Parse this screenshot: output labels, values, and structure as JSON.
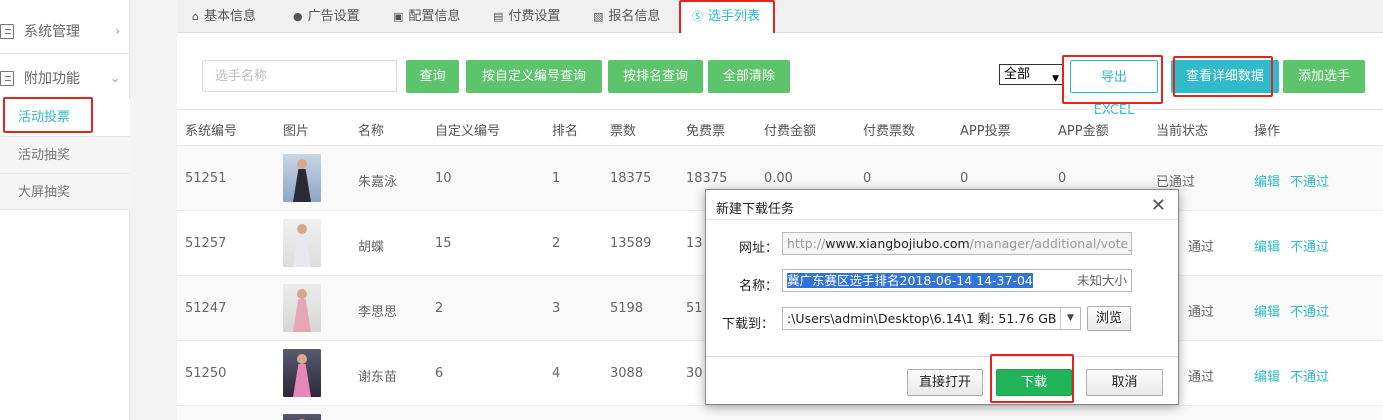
{
  "sidebar": {
    "items": [
      {
        "label": "系统管理",
        "arrow": "›"
      },
      {
        "label": "附加功能",
        "arrow": "⌄"
      }
    ],
    "sub_items": [
      {
        "label": "活动投票"
      },
      {
        "label": "活动抽奖"
      },
      {
        "label": "大屏抽奖"
      }
    ]
  },
  "tabs": [
    {
      "icon": "⌂",
      "label": "基本信息"
    },
    {
      "icon": "●",
      "label": "广告设置"
    },
    {
      "icon": "▣",
      "label": "配置信息"
    },
    {
      "icon": "▤",
      "label": "付费设置"
    },
    {
      "icon": "▧",
      "label": "报名信息"
    },
    {
      "icon": "Ⓢ",
      "label": "选手列表"
    }
  ],
  "toolbar": {
    "search_placeholder": "选手名称",
    "query": "查询",
    "query_custom_no": "按自定义编号查询",
    "query_rank": "按排名查询",
    "clear_all": "全部清除",
    "filter_value": "全部",
    "export_excel": "导出EXCEL",
    "view_detail": "查看详细数据",
    "add_player": "添加选手"
  },
  "table": {
    "headers": [
      "系统编号",
      "图片",
      "名称",
      "自定义编号",
      "排名",
      "票数",
      "免费票",
      "付费金额",
      "付费票数",
      "APP投票",
      "APP金额",
      "当前状态",
      "操作"
    ],
    "rows": [
      {
        "id": "51251",
        "name": "朱嘉泳",
        "custom_no": "10",
        "rank": "1",
        "votes": "18375",
        "free": "18375",
        "paid_amount": "0.00",
        "paid_votes": "0",
        "app_votes": "0",
        "app_amount": "0",
        "status": "已通过",
        "edit": "编辑",
        "reject": "不通过"
      },
      {
        "id": "51257",
        "name": "胡蝶",
        "custom_no": "15",
        "rank": "2",
        "votes": "13589",
        "free": "13",
        "paid_amount": "",
        "paid_votes": "",
        "app_votes": "",
        "app_amount": "",
        "status": "通过",
        "edit": "编辑",
        "reject": "不通过"
      },
      {
        "id": "51247",
        "name": "李思思",
        "custom_no": "2",
        "rank": "3",
        "votes": "5198",
        "free": "51",
        "paid_amount": "",
        "paid_votes": "",
        "app_votes": "",
        "app_amount": "",
        "status": "通过",
        "edit": "编辑",
        "reject": "不通过"
      },
      {
        "id": "51250",
        "name": "谢东苗",
        "custom_no": "6",
        "rank": "4",
        "votes": "3088",
        "free": "30",
        "paid_amount": "",
        "paid_votes": "",
        "app_votes": "",
        "app_amount": "",
        "status": "通过",
        "edit": "编辑",
        "reject": "不通过"
      }
    ]
  },
  "dialog": {
    "title": "新建下载任务",
    "close": "✕",
    "url_label": "网址：",
    "url_prefix": "http://",
    "url_domain": "www.xiangbojiubo.com",
    "url_rest": "/manager/additional/vote_use",
    "name_label": "名称：",
    "name_value": "冀广东赛区选手排名2018-06-14 14-37-04",
    "name_size": "未知大小",
    "path_label": "下载到：",
    "path_value": ":\\Users\\admin\\Desktop\\6.14\\1 剩: 51.76 GB",
    "browse": "浏览",
    "open_direct": "直接打开",
    "download": "下载",
    "cancel": "取消"
  }
}
